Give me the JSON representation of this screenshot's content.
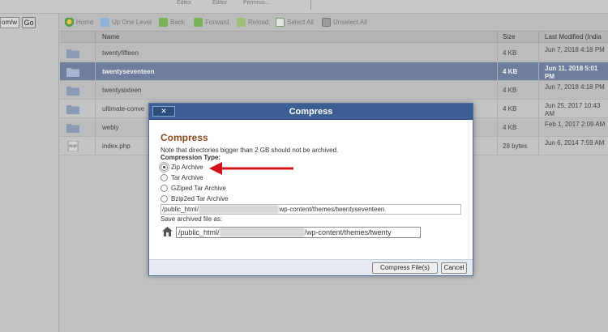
{
  "topbar": {
    "labels": [
      "Editor",
      "Editor",
      "Permissi..."
    ]
  },
  "leftpanel": {
    "path_value": "om/w",
    "go_label": "Go"
  },
  "navbar": {
    "home": "Home",
    "up_one_level": "Up One Level",
    "back": "Back",
    "forward": "Forward",
    "reload": "Reload",
    "select_all": "Select All",
    "unselect_all": "Unselect All"
  },
  "table": {
    "headers": {
      "name": "Name",
      "size": "Size",
      "modified": "Last Modified (India"
    },
    "rows": [
      {
        "name": "twentyfifteen",
        "size": "4 KB",
        "modified": "Jun 7, 2018 4:18 PM",
        "icon": "folder-icon"
      },
      {
        "name": "twentyseventeen",
        "size": "4 KB",
        "modified": "Jun 11, 2018 5:01 PM",
        "icon": "folder-icon",
        "selected": true
      },
      {
        "name": "twentysixteen",
        "size": "4 KB",
        "modified": "Jun 7, 2018 4:18 PM",
        "icon": "folder-icon"
      },
      {
        "name": "ultimate-conve",
        "size": "4 KB",
        "modified": "Jun 25, 2017 10:43 AM",
        "icon": "folder-icon"
      },
      {
        "name": "webly",
        "size": "4 KB",
        "modified": "Feb 1, 2017 2:09 AM",
        "icon": "folder-icon"
      },
      {
        "name": "index.php",
        "size": "28 bytes",
        "modified": "Jun 6, 2014 7:59 AM",
        "icon": "php-file-icon"
      }
    ]
  },
  "dialog": {
    "title": "Compress",
    "close_label": "✕",
    "heading": "Compress",
    "note": "Note that directories bigger than 2 GB should not be archived.",
    "type_label": "Compression Type:",
    "options": [
      "Zip Archive",
      "Tar Archive",
      "GZiped Tar Archive",
      "Bzip2ed Tar Archive"
    ],
    "selected_option": "Zip Archive",
    "source_prefix": "/public_html/",
    "source_suffix": "wp-content/themes/twentyseventeen",
    "save_label": "Save archived file as:",
    "dest_prefix": "/public_html/",
    "dest_suffix": "/wp-content/themes/twenty",
    "compress_button": "Compress File(s)",
    "cancel_button": "Cancel"
  },
  "colors": {
    "dialog_title_bg": "#3b5e93",
    "heading": "#8a4a1e",
    "selected_row": "#6f7e9e",
    "arrow": "#d0121b"
  }
}
